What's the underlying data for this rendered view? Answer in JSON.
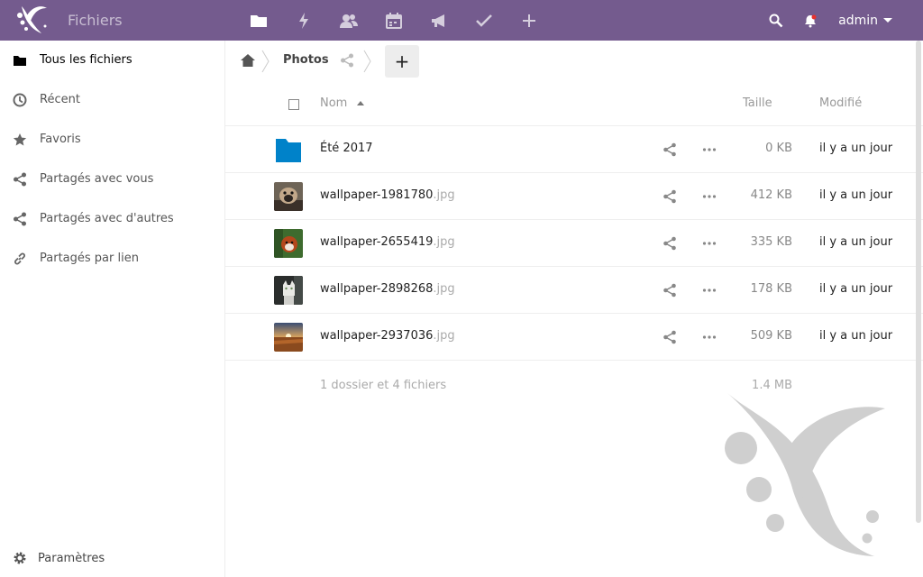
{
  "header": {
    "app_title": "Fichiers",
    "user": "admin",
    "accent": "#745b8e",
    "apps": [
      {
        "name": "files-icon"
      },
      {
        "name": "activity-icon"
      },
      {
        "name": "contacts-icon"
      },
      {
        "name": "calendar-icon"
      },
      {
        "name": "announcements-icon"
      },
      {
        "name": "tasks-icon"
      },
      {
        "name": "more-apps-icon"
      }
    ]
  },
  "sidebar": {
    "items": [
      {
        "label": "Tous les fichiers",
        "icon": "folder-icon",
        "active": true
      },
      {
        "label": "Récent",
        "icon": "clock-icon"
      },
      {
        "label": "Favoris",
        "icon": "star-icon"
      },
      {
        "label": "Partagés avec vous",
        "icon": "share-icon"
      },
      {
        "label": "Partagés avec d'autres",
        "icon": "share-icon"
      },
      {
        "label": "Partagés par lien",
        "icon": "link-icon"
      }
    ],
    "settings_label": "Paramètres"
  },
  "breadcrumb": {
    "folder": "Photos",
    "new_label": "+"
  },
  "table": {
    "col_name": "Nom",
    "col_size": "Taille",
    "col_modified": "Modifié",
    "rows": [
      {
        "name": "Été 2017",
        "ext": "",
        "size": "0 KB",
        "modified": "il y a un jour",
        "kind": "folder"
      },
      {
        "name": "wallpaper-1981780",
        "ext": ".jpg",
        "size": "412 KB",
        "modified": "il y a un jour",
        "kind": "image"
      },
      {
        "name": "wallpaper-2655419",
        "ext": ".jpg",
        "size": "335 KB",
        "modified": "il y a un jour",
        "kind": "image"
      },
      {
        "name": "wallpaper-2898268",
        "ext": ".jpg",
        "size": "178 KB",
        "modified": "il y a un jour",
        "kind": "image"
      },
      {
        "name": "wallpaper-2937036",
        "ext": ".jpg",
        "size": "509 KB",
        "modified": "il y a un jour",
        "kind": "image"
      }
    ],
    "summary": "1 dossier et 4 fichiers",
    "summary_size": "1.4 MB"
  }
}
